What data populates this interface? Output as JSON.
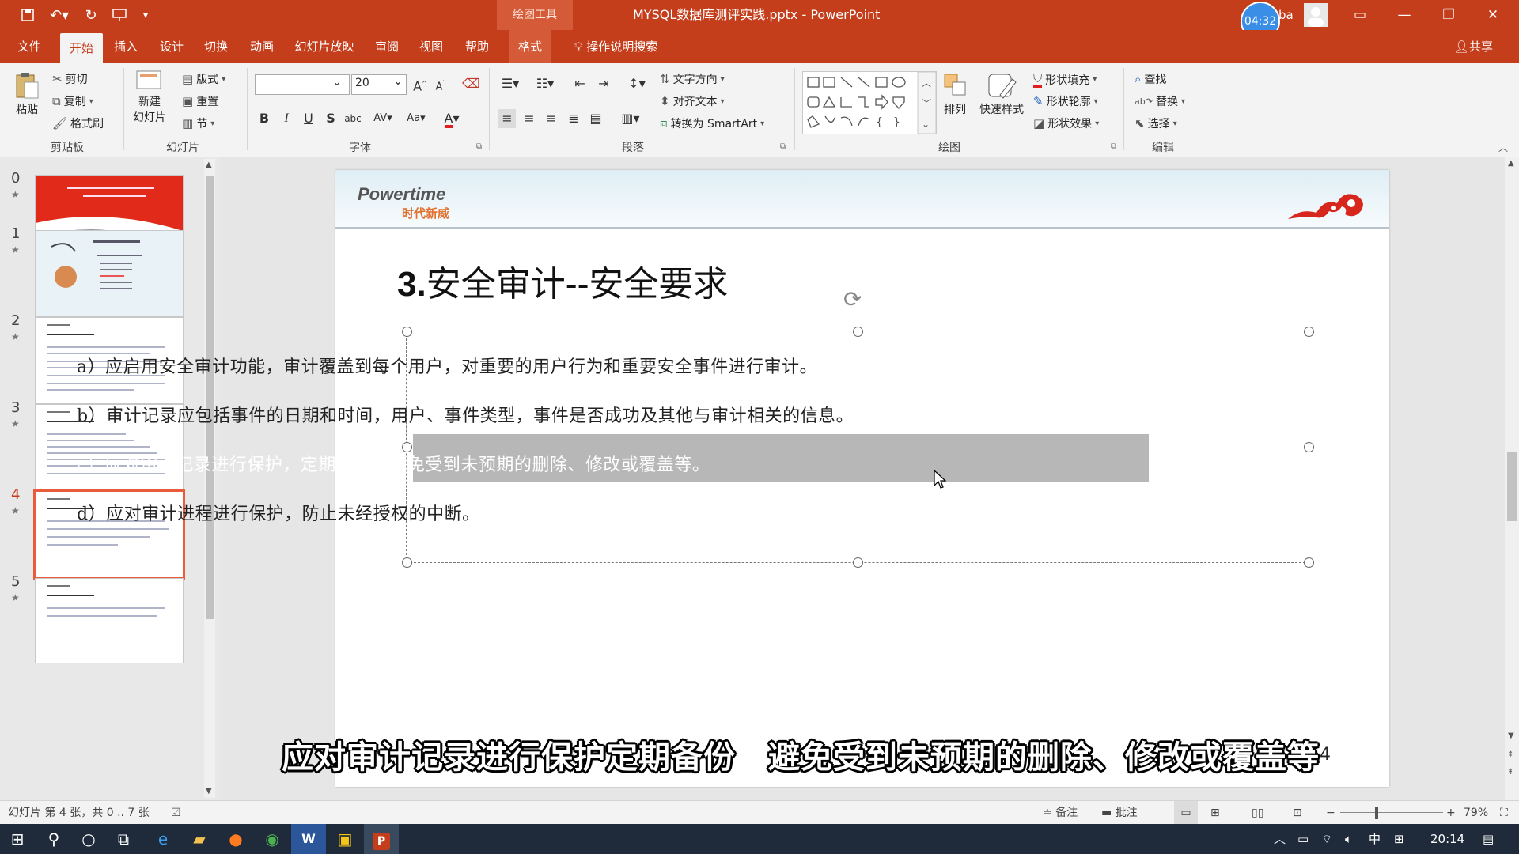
{
  "titlebar": {
    "context_tab": "绘图工具",
    "title": "MYSQL数据库测评实践.pptx - PowerPoint",
    "timer": "04:32",
    "user": "ba",
    "icons": [
      "save-icon",
      "undo-icon",
      "redo-icon",
      "present-icon",
      "customize-icon"
    ]
  },
  "tabs": [
    "文件",
    "开始",
    "插入",
    "设计",
    "切换",
    "动画",
    "幻灯片放映",
    "审阅",
    "视图",
    "帮助",
    "格式"
  ],
  "tell_me": "操作说明搜索",
  "share": "共享",
  "ribbon": {
    "clipboard": {
      "paste": "粘贴",
      "cut": "剪切",
      "copy": "复制",
      "format_painter": "格式刷",
      "group": "剪贴板"
    },
    "slides": {
      "new_slide_1": "新建",
      "new_slide_2": "幻灯片",
      "layout": "版式",
      "reset": "重置",
      "section": "节",
      "group": "幻灯片"
    },
    "font": {
      "font_name": "",
      "font_size": "20",
      "group": "字体",
      "case": "Aa",
      "spacing": "AV"
    },
    "paragraph": {
      "text_direction": "文字方向",
      "align_text": "对齐文本",
      "smartart": "转换为 SmartArt",
      "group": "段落"
    },
    "drawing": {
      "arrange": "排列",
      "quick_styles": "快速样式",
      "shape_fill": "形状填充",
      "shape_outline": "形状轮廓",
      "shape_effects": "形状效果",
      "group": "绘图"
    },
    "editing": {
      "find": "查找",
      "replace": "替换",
      "select": "选择",
      "group": "编辑"
    }
  },
  "thumbnails": [
    {
      "num": "0",
      "star": "★"
    },
    {
      "num": "1",
      "star": "★"
    },
    {
      "num": "2",
      "star": "★"
    },
    {
      "num": "3",
      "star": "★"
    },
    {
      "num": "4",
      "star": "★"
    },
    {
      "num": "5",
      "star": "★"
    }
  ],
  "slide": {
    "logo_main": "Powertime",
    "logo_sub": "时代新威",
    "heading_num": "3.",
    "heading_text": "安全审计--安全要求",
    "lines": [
      "a）应启用安全审计功能，审计覆盖到每个用户，对重要的用户行为和重要安全事件进行审计。",
      "b）审计记录应包括事件的日期和时间，用户、事件类型，事件是否成功及其他与审计相关的信息。",
      "c）应对审计记录进行保护，定期备份，避免受到未预期的删除、修改或覆盖等。",
      "d）应对审计进程进行保护，防止未经授权的中断。"
    ],
    "page_number": "4"
  },
  "caption": "应对审计记录进行保护定期备份　避免受到未预期的删除、修改或覆盖等",
  "status": {
    "slide_info": "幻灯片 第 4 张，共 0 .. 7 张",
    "notes": "备注",
    "comments": "批注",
    "zoom": "79%"
  },
  "taskbar": {
    "time": "20:14",
    "ime": "中"
  }
}
